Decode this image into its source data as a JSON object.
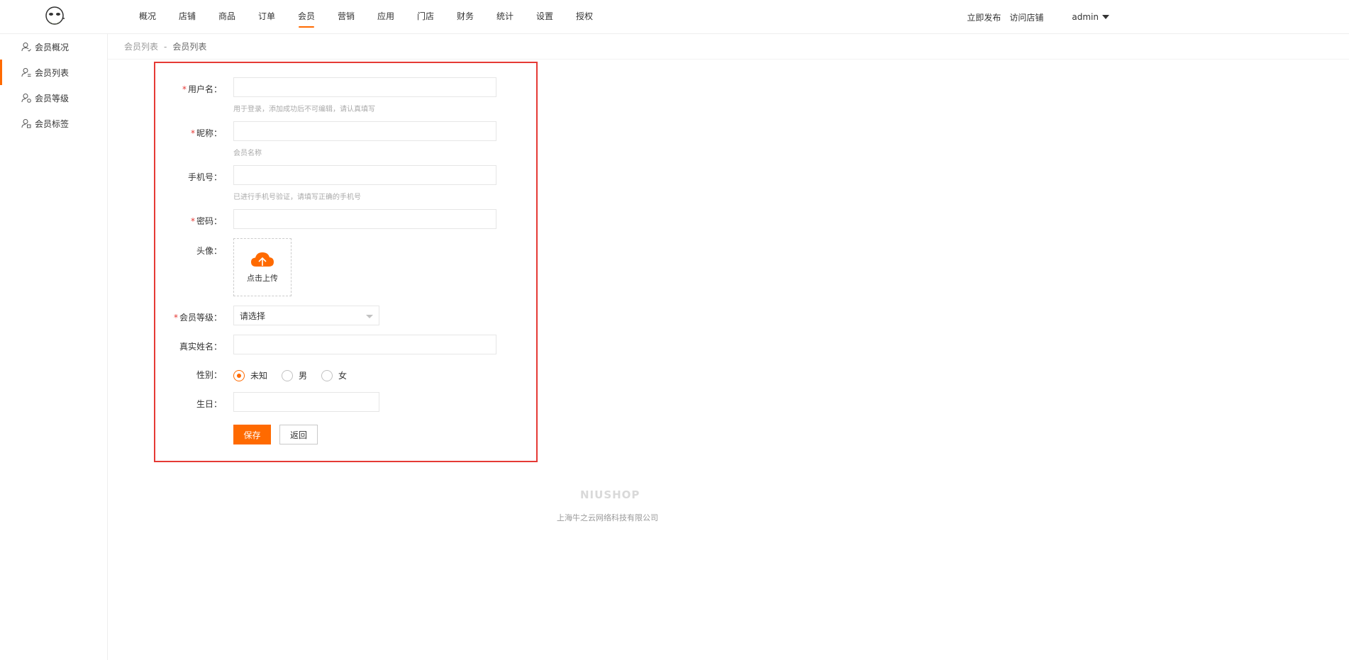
{
  "header": {
    "nav": [
      "概况",
      "店铺",
      "商品",
      "订单",
      "会员",
      "营销",
      "应用",
      "门店",
      "财务",
      "统计",
      "设置",
      "授权"
    ],
    "active_nav": "会员",
    "publish_label": "立即发布",
    "visit_store_label": "访问店铺",
    "user_name": "admin"
  },
  "sidebar": {
    "items": [
      {
        "label": "会员概况",
        "icon": "user-check-icon"
      },
      {
        "label": "会员列表",
        "icon": "user-list-icon"
      },
      {
        "label": "会员等级",
        "icon": "user-level-icon"
      },
      {
        "label": "会员标签",
        "icon": "user-tag-icon"
      }
    ],
    "active_index": 1
  },
  "breadcrumb": {
    "parent": "会员列表",
    "separator": "-",
    "current": "会员列表"
  },
  "form": {
    "username": {
      "label": "用户名：",
      "required": true,
      "value": "",
      "hint": "用于登录，添加成功后不可编辑，请认真填写"
    },
    "nickname": {
      "label": "昵称：",
      "required": true,
      "value": "",
      "hint": "会员名称"
    },
    "mobile": {
      "label": "手机号：",
      "required": false,
      "value": "",
      "hint": "已进行手机号验证，请填写正确的手机号"
    },
    "password": {
      "label": "密码：",
      "required": true,
      "value": ""
    },
    "avatar": {
      "label": "头像：",
      "upload_label": "点击上传"
    },
    "level": {
      "label": "会员等级：",
      "required": true,
      "selected": "请选择"
    },
    "real_name": {
      "label": "真实姓名：",
      "value": ""
    },
    "gender": {
      "label": "性别：",
      "options": [
        "未知",
        "男",
        "女"
      ],
      "selected": "未知"
    },
    "birthday": {
      "label": "生日：",
      "value": ""
    },
    "save_label": "保存",
    "back_label": "返回"
  },
  "footer": {
    "logo": "NIUSHOP",
    "company": "上海牛之云网络科技有限公司"
  },
  "colors": {
    "accent": "#ff6a00",
    "highlight_border": "#e53935"
  }
}
